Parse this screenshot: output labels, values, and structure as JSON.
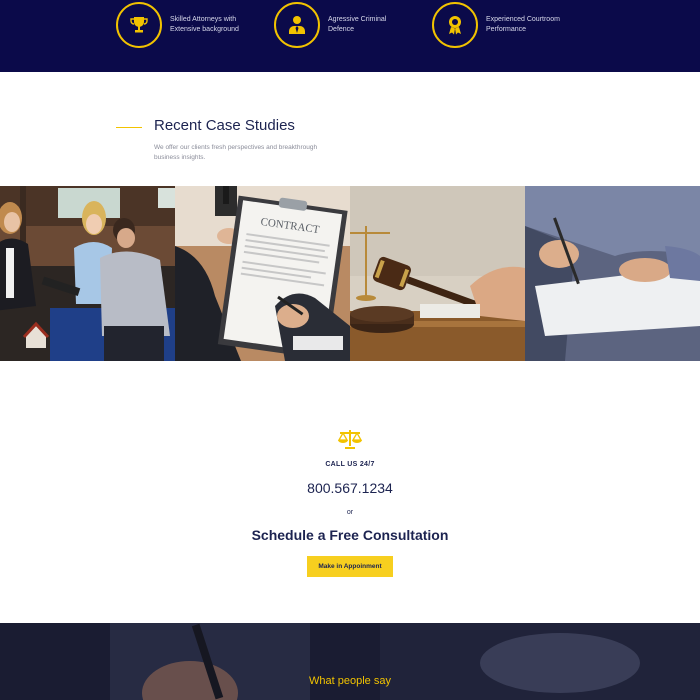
{
  "features": [
    {
      "icon": "trophy-icon",
      "text": "Skilled Attorneys with Extensive background"
    },
    {
      "icon": "attorney-icon",
      "text": "Agressive Criminal Defence"
    },
    {
      "icon": "award-icon",
      "text": "Experienced Courtroom Performance"
    }
  ],
  "case_studies": {
    "title": "Recent Case Studies",
    "subtitle": "We offer our clients fresh perspectives and breakthrough business insights.",
    "photos": [
      {
        "name": "clients-meeting-photo"
      },
      {
        "name": "contract-signing-photo",
        "text": "CONTRACT"
      },
      {
        "name": "gavel-photo"
      },
      {
        "name": "document-signing-photo"
      }
    ]
  },
  "cta": {
    "icon": "scales-icon",
    "call_label": "CALL US 24/7",
    "phone": "800.567.1234",
    "or": "or",
    "title": "Schedule a Free Consultation",
    "button": "Make in Appoinment"
  },
  "testimonials": {
    "title": "What people say"
  },
  "colors": {
    "navy": "#0b0a4a",
    "accent": "#f2c300",
    "heading": "#1c2350",
    "button": "#f7cf1f"
  }
}
